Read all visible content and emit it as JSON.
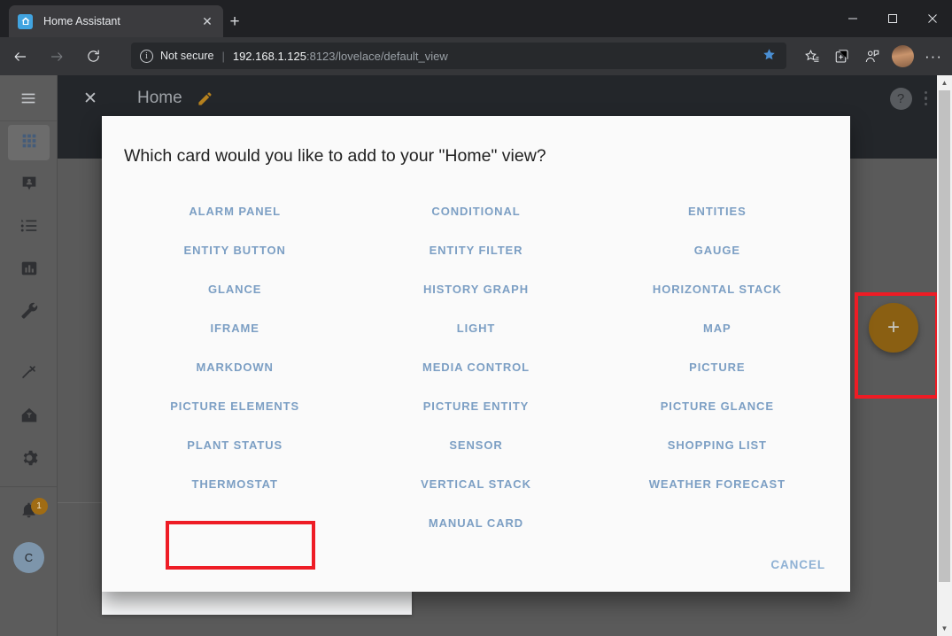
{
  "browser": {
    "tab": {
      "title": "Home Assistant",
      "favicon_icon": "home-assistant-favicon",
      "close_icon": "close-icon"
    },
    "new_tab_icon": "plus-icon",
    "window_controls": {
      "minimize": "─",
      "maximize": "☐",
      "close": "✕"
    },
    "nav": {
      "back_icon": "arrow-left-icon",
      "forward_icon": "arrow-right-icon",
      "reload_icon": "reload-icon"
    },
    "omnibox": {
      "info_icon": "info-circle-icon",
      "security_label": "Not secure",
      "separator": "|",
      "url_host": "192.168.1.125",
      "url_path": ":8123/lovelace/default_view",
      "star_icon": "star-filled-icon"
    },
    "toolbar_icons": [
      "favorites-icon",
      "collections-icon",
      "share-icon",
      "profile-avatar",
      "more-icon"
    ],
    "more_glyph": "···"
  },
  "ha": {
    "sidebar": {
      "menu_icon": "hamburger-menu-icon",
      "items": [
        {
          "name": "sidebar-item-overview",
          "icon": "grid-icon",
          "active": true
        },
        {
          "name": "sidebar-item-map",
          "icon": "map-marker-account-icon",
          "active": false
        },
        {
          "name": "sidebar-item-logbook",
          "icon": "logbook-list-icon",
          "active": false
        },
        {
          "name": "sidebar-item-history",
          "icon": "chart-bar-icon",
          "active": false
        },
        {
          "name": "sidebar-item-supervisor",
          "icon": "wrench-icon",
          "active": false
        },
        {
          "name": "sidebar-item-developer-tools",
          "icon": "hammer-icon",
          "active": false
        },
        {
          "name": "sidebar-item-home",
          "icon": "home-assistant-logo-icon",
          "active": false
        },
        {
          "name": "sidebar-item-configuration",
          "icon": "gear-icon",
          "active": false
        }
      ],
      "notifications": {
        "icon": "bell-icon",
        "badge": "1"
      },
      "user": {
        "avatar_initial": "C"
      }
    },
    "header": {
      "close_icon": "close-icon",
      "title": "Home",
      "edit_icon": "pencil-icon",
      "help_icon": "help-circle-icon",
      "overflow_icon": "kebab-menu-icon"
    },
    "fab": {
      "icon": "plus-icon",
      "label": "+"
    }
  },
  "dialog": {
    "title": "Which card would you like to add to your \"Home\" view?",
    "cards": [
      "ALARM PANEL",
      "CONDITIONAL",
      "ENTITIES",
      "ENTITY BUTTON",
      "ENTITY FILTER",
      "GAUGE",
      "GLANCE",
      "HISTORY GRAPH",
      "HORIZONTAL STACK",
      "IFRAME",
      "LIGHT",
      "MAP",
      "MARKDOWN",
      "MEDIA CONTROL",
      "PICTURE",
      "PICTURE ELEMENTS",
      "PICTURE ENTITY",
      "PICTURE GLANCE",
      "PLANT STATUS",
      "SENSOR",
      "SHOPPING LIST",
      "THERMOSTAT",
      "VERTICAL STACK",
      "WEATHER FORECAST"
    ],
    "manual_card": "MANUAL CARD",
    "cancel": "CANCEL"
  },
  "annotations": {
    "highlight_thermostat": "THERMOSTAT",
    "highlight_add_card_button": "add-card-fab",
    "color": "#ee1c25"
  },
  "colors": {
    "accent_orange": "#8a5f12",
    "link_blue": "#7c9fc4",
    "header_dark": "#23262a",
    "dialog_bg": "#fafafa",
    "annotation_red": "#ee1c25"
  },
  "scrollbar": {
    "up_arrow": "▲",
    "down_arrow": "▼"
  }
}
